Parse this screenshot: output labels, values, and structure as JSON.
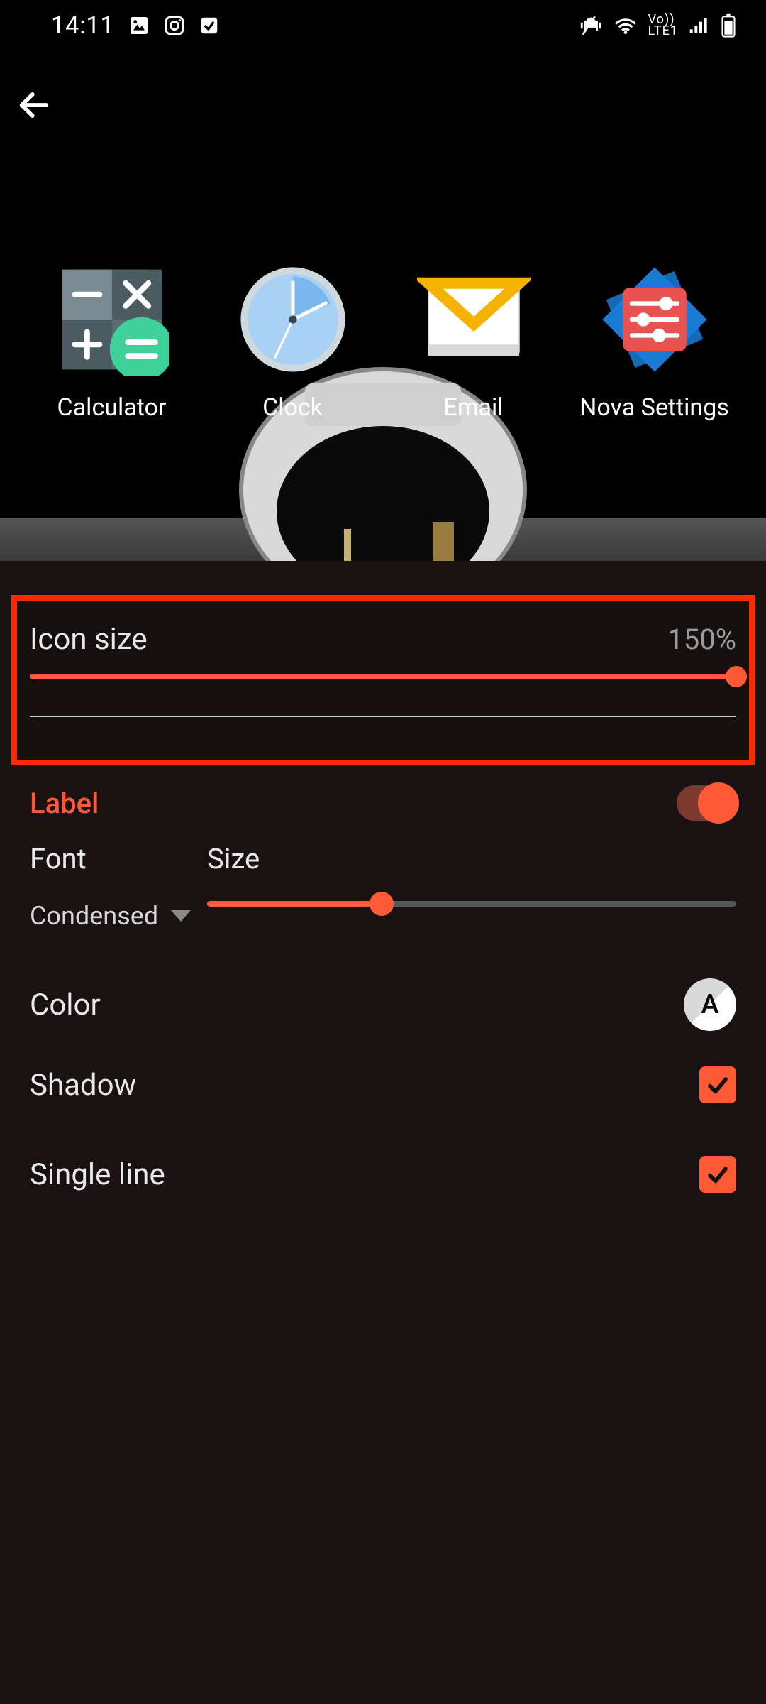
{
  "status": {
    "time": "14:11",
    "net_label": "Vo))\nLTE1"
  },
  "preview": {
    "apps": [
      {
        "label": "Calculator"
      },
      {
        "label": "Clock"
      },
      {
        "label": "Email"
      },
      {
        "label": "Nova Settings"
      }
    ]
  },
  "settings": {
    "icon_size": {
      "label": "Icon size",
      "value_text": "150%",
      "percent": 100
    },
    "label_section": {
      "title": "Label",
      "enabled": true,
      "font": {
        "header": "Font",
        "value": "Condensed"
      },
      "size": {
        "header": "Size",
        "percent": 33
      },
      "color": {
        "label": "Color",
        "chip_text": "A"
      },
      "shadow": {
        "label": "Shadow",
        "checked": true
      },
      "single_line": {
        "label": "Single line",
        "checked": true
      }
    }
  },
  "colors": {
    "accent": "#fe5a36"
  }
}
